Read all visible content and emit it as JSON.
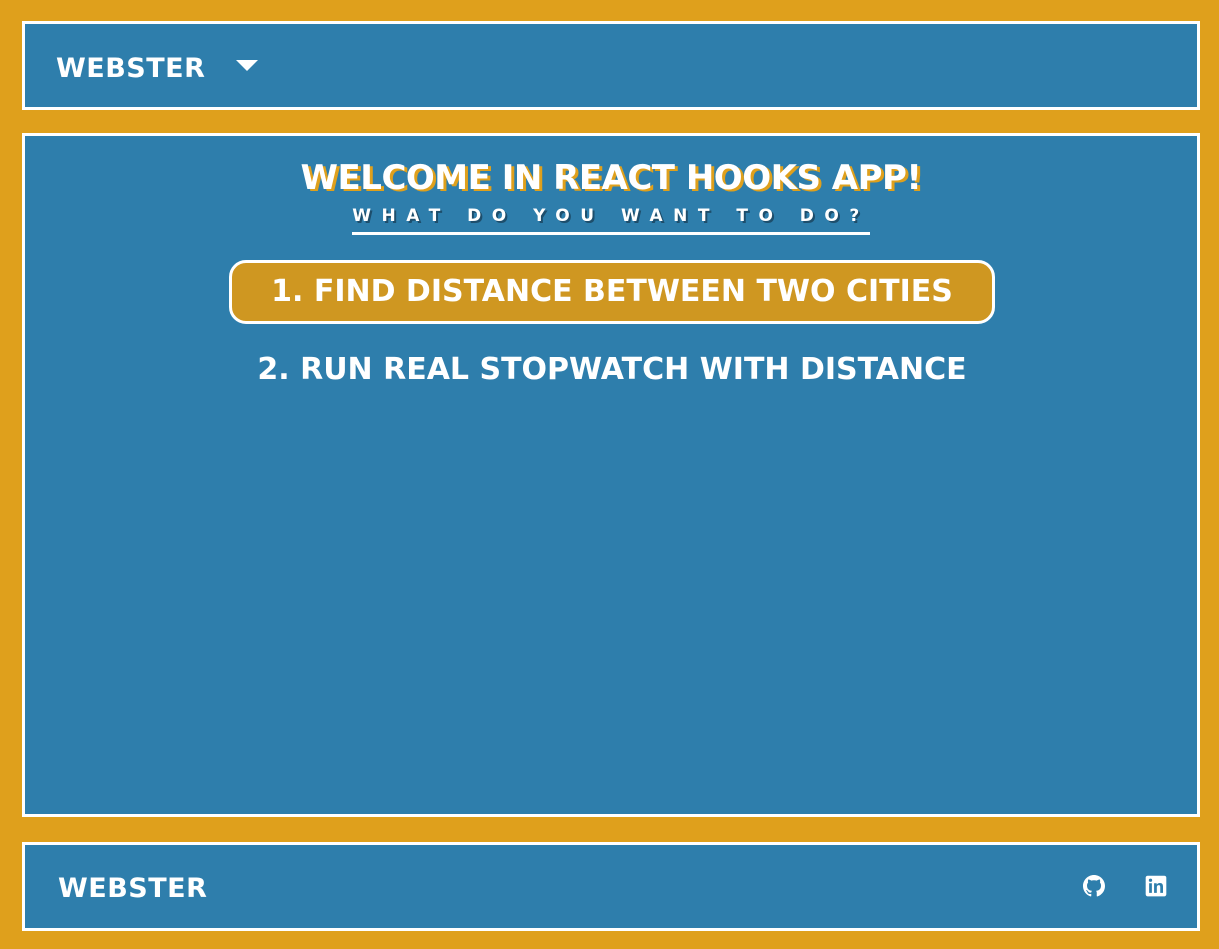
{
  "header": {
    "brand": "WEBSTER"
  },
  "main": {
    "title": "WELCOME IN REACT HOOKS APP!",
    "subtitle": "WHAT DO YOU WANT TO DO?",
    "options": [
      {
        "label": "1. FIND DISTANCE BETWEEN TWO CITIES",
        "active": true
      },
      {
        "label": "2. RUN REAL STOPWATCH WITH DISTANCE",
        "active": false
      }
    ]
  },
  "footer": {
    "brand": "WEBSTER",
    "icons": [
      "github-icon",
      "linkedin-icon"
    ]
  },
  "colors": {
    "background": "#dfa01c",
    "panel": "#2e7eac",
    "accent": "#cf9721",
    "text": "#ffffff"
  }
}
